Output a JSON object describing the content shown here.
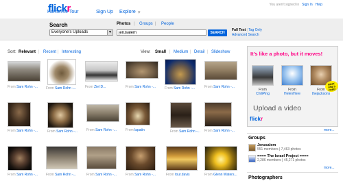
{
  "header": {
    "logo_text_1": "flick",
    "logo_text_2": "r",
    "nav": [
      "Home",
      "The Tour",
      "Sign Up",
      "Explore"
    ],
    "explore_caret": "▾",
    "signin_status": "You aren't signed in",
    "signin_link": "Sign In",
    "help_link": "Help"
  },
  "search": {
    "title": "Search",
    "scope_value": "Everyone's Uploads",
    "tabs": [
      "Photos",
      "Groups",
      "People"
    ],
    "query": "jerusalem",
    "button": "SEARCH",
    "fulltext": "Full Text",
    "tags_only": "Tag Only",
    "advanced": "Advanced Search"
  },
  "sort": {
    "label": "Sort:",
    "options": [
      "Relevant",
      "Recent",
      "Interesting"
    ],
    "active": "Relevant"
  },
  "view": {
    "label": "View:",
    "options": [
      "Small",
      "Medium",
      "Detail",
      "Slideshow"
    ],
    "active": "Small"
  },
  "photos": [
    {
      "from": "From",
      "owner": "Sam Rohn -...",
      "icon": "city-skyline-thumb"
    },
    {
      "from": "From",
      "owner": "Sam Rohn -...",
      "icon": "tiny-planet-thumb"
    },
    {
      "from": "From",
      "owner": "Ziel D...",
      "icon": "snow-street-thumb"
    },
    {
      "from": "From",
      "owner": "Sam Rohn -...",
      "icon": "panorama-plaza-thumb"
    },
    {
      "from": "From",
      "owner": "Sam Rohn -...",
      "icon": "tiny-planet-dusk-thumb"
    },
    {
      "from": "From",
      "owner": "Sam Rohn -...",
      "icon": "stone-courtyard-thumb"
    },
    {
      "from": "From",
      "owner": "Sam Rohn -...",
      "icon": "wall-figure-thumb"
    },
    {
      "from": "From",
      "owner": "Sam Rohn -...",
      "icon": "dome-interior-thumb"
    },
    {
      "from": "From",
      "owner": "Sam Rohn -...",
      "icon": "crowd-panorama-thumb"
    },
    {
      "from": "From",
      "owner": "lapatin",
      "icon": "arch-tunnel-thumb"
    },
    {
      "from": "From",
      "owner": "Sam Rohn -...",
      "icon": "dark-hall-thumb"
    },
    {
      "from": "From",
      "owner": "Sam Rohn -...",
      "icon": "market-street-thumb"
    },
    {
      "from": "From",
      "owner": "Sam Rohn -...",
      "icon": "tiny-planet-night-thumb"
    },
    {
      "from": "From",
      "owner": "Sam Rohn -...",
      "icon": "old-city-wall-thumb"
    },
    {
      "from": "From",
      "owner": "Sam Rohn -...",
      "icon": "gate-arch-thumb"
    },
    {
      "from": "From",
      "owner": "Sam Rohn -...",
      "icon": "lit-interior-thumb"
    },
    {
      "from": "From",
      "owner": "tour.davis",
      "icon": "golden-dome-thumb"
    },
    {
      "from": "From",
      "owner": "Glenn Waters...",
      "icon": "yellow-flower-thumb"
    }
  ],
  "ad": {
    "headline": "It's like a photo, but it moves!",
    "items": [
      {
        "from": "From",
        "owner": "ChiliPing",
        "icon": "ad-cat-thumb"
      },
      {
        "from": "From",
        "owner": "HelenHere",
        "icon": "ad-baby-thumb"
      },
      {
        "from": "From",
        "owner": "thejacksons",
        "icon": "ad-dog-thumb"
      }
    ],
    "badge": "FIRST ONE'S FREE!",
    "upload": "Upload a video",
    "logo_1": "flick",
    "logo_2": "r",
    "more": "more..."
  },
  "groups": {
    "title": "Groups",
    "items": [
      {
        "name": "Jerusalem",
        "members": "551 members",
        "photos": "7,463 photos",
        "icon": "jerusalem-group-icon"
      },
      {
        "name": "==== The Israel Project ====",
        "members": "2,286 members",
        "photos": "45,271 photos",
        "icon": "israel-project-group-icon"
      }
    ],
    "sep": "|",
    "more": "more..."
  },
  "photographers": {
    "title": "Photographers"
  },
  "colors": {
    "link": "#0063dc",
    "brand_pink": "#ff0084",
    "search_band": "#eeeeee"
  }
}
